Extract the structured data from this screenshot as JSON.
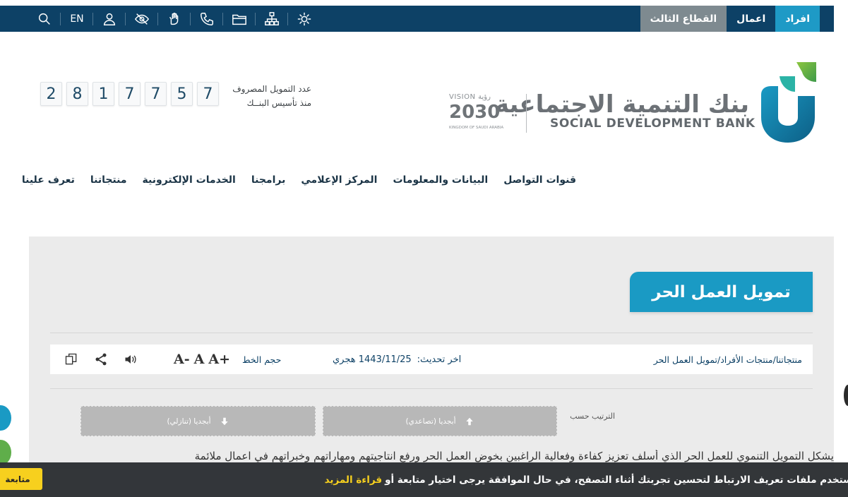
{
  "colors": {
    "topbar": "#0d4166",
    "accent": "#1a9ac4",
    "tab_third": "#7e8a90",
    "content_bg": "#ebebeb",
    "cookie_bg": "#2f3236",
    "cookie_accent": "#f7d01a",
    "logo_green": "#5fae4a"
  },
  "topbar": {
    "tabs": [
      "افراد",
      "اعمال",
      "القطاع الثالث"
    ],
    "language": "EN",
    "icons": [
      "search-icon",
      "language-toggle",
      "user-icon",
      "eye-slash-icon",
      "sign-language-icon",
      "phone-icon",
      "folder-icon",
      "sitemap-icon",
      "settings-icon"
    ]
  },
  "header": {
    "bank_name_ar": "بنك التنمية الاجتماعية",
    "bank_name_en": "SOCIAL DEVELOPMENT BANK",
    "vision_top": "VISION رؤية",
    "vision_year": "2030",
    "vision_sub": "KINGDOM OF SAUDI ARABIA",
    "counter_digits": [
      "2",
      "8",
      "1",
      "7",
      "7",
      "5",
      "7"
    ],
    "counter_label_line1": "عدد التمويل المصروف",
    "counter_label_line2": "منذ تأسيس البنــك"
  },
  "nav": [
    "تعرف علينا",
    "منتجاتنا",
    "الخدمات الإلكترونية",
    "برامجنا",
    "المركز الإعلامي",
    "البيانات والمعلومات",
    "قنوات التواصل"
  ],
  "page": {
    "title": "تمويل العمل الحر",
    "breadcrumb": "منتجاتنا/منتجات الأفراد/تمويل العمل الحر",
    "updated_label": "اخر تحديث:",
    "updated_value": "1443/11/25 هجري",
    "font_size_label": "حجم الخط",
    "font_plus": "A+",
    "font_normal": "A",
    "font_minus": "A-",
    "sort_label": "الترتيب حسب",
    "sort_asc": "أبجديا (تصاعدي)",
    "sort_desc": "أبجديا (تنازلي)",
    "paragraph_start": "يشكل التمويل التنموي للعمل الحر الذي أسلف تعزيز كفاءة وفعالية الراغبين بخوض العمل الحر ورفع انتاجيتهم ومهاراتهم وخبراتهم في اعمال ملائمة"
  },
  "cookie": {
    "text": "نستخدم ملفات تعريف الارتباط لتحسين تجربتك أثناء التصفح، في حال الموافقة يرجى اختيار متابعة أو",
    "link": "قراءة المزيد",
    "button": "متابعة"
  }
}
